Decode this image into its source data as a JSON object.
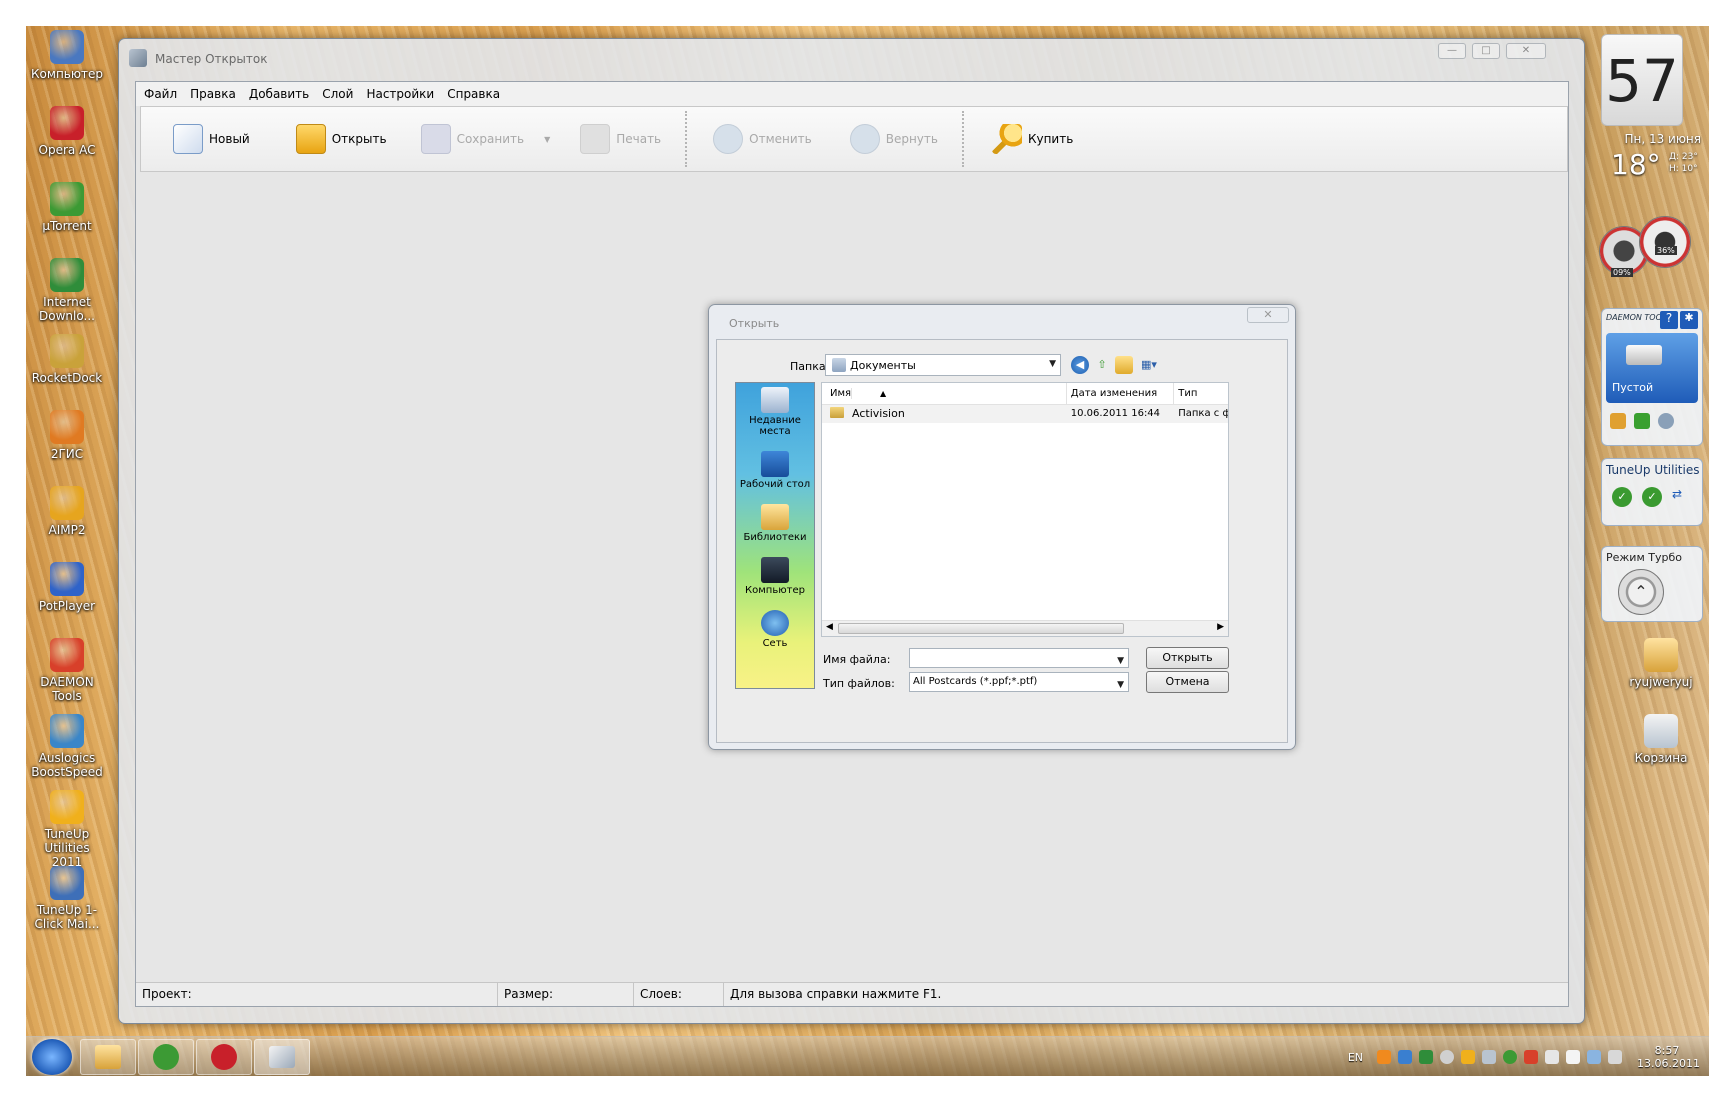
{
  "desktop_icons": [
    {
      "label": "Компьютер",
      "icon": "computer-icon",
      "color": "#4a78c0"
    },
    {
      "label": "Opera AC",
      "icon": "opera-icon",
      "color": "#c8202a"
    },
    {
      "label": "µTorrent",
      "icon": "utorrent-icon",
      "color": "#3c9a34"
    },
    {
      "label": "Internet Downlo...",
      "icon": "internet-download-icon",
      "color": "#2f8d3a"
    },
    {
      "label": "RocketDock",
      "icon": "rocketdock-icon",
      "color": "#c9a23a"
    },
    {
      "label": "2ГИС",
      "icon": "2gis-icon",
      "color": "#e07a22"
    },
    {
      "label": "AIMP2",
      "icon": "aimp-icon",
      "color": "#e6a51e"
    },
    {
      "label": "PotPlayer",
      "icon": "potplayer-icon",
      "color": "#2f63c9"
    },
    {
      "label": "DAEMON Tools",
      "icon": "daemon-tools-icon",
      "color": "#d8402a"
    },
    {
      "label": "Auslogics BoostSpeed",
      "icon": "auslogics-icon",
      "color": "#3a86c8"
    },
    {
      "label": "TuneUp Utilities 2011",
      "icon": "tuneup-icon",
      "color": "#f0b01c"
    },
    {
      "label": "TuneUp 1-Click Mai...",
      "icon": "tuneup-1click-icon",
      "color": "#3e6fb8"
    }
  ],
  "right_icons": [
    {
      "label": "ryujweryuj",
      "icon": "folder-icon"
    },
    {
      "label": "Корзина",
      "icon": "recycle-bin-icon"
    }
  ],
  "app": {
    "title": "Мастер Открыток",
    "menu": [
      "Файл",
      "Правка",
      "Добавить",
      "Слой",
      "Настройки",
      "Справка"
    ],
    "toolbar": {
      "new": "Новый",
      "open": "Открыть",
      "save": "Сохранить",
      "print": "Печать",
      "undo": "Отменить",
      "redo": "Вернуть",
      "buy": "Купить"
    },
    "status": {
      "project": "Проект:",
      "size": "Размер:",
      "layers": "Слоев:",
      "help": "Для вызова справки нажмите F1."
    }
  },
  "dialog": {
    "title": "Открыть",
    "lookin_label": "Папка:",
    "lookin_value": "Документы",
    "places": [
      "Недавние места",
      "Рабочий стол",
      "Библиотеки",
      "Компьютер",
      "Сеть"
    ],
    "columns": {
      "name": "Имя",
      "date": "Дата изменения",
      "type": "Тип"
    },
    "files": [
      {
        "name": "Activision",
        "date": "10.06.2011 16:44",
        "type": "Папка с ф"
      }
    ],
    "filename_label": "Имя файла:",
    "filename_value": "",
    "filetype_label": "Тип файлов:",
    "filetype_value": "All Postcards (*.ppf;*.ptf)",
    "open_button": "Открыть",
    "cancel_button": "Отмена"
  },
  "gadgets": {
    "clock_minutes": "57",
    "weather_date": "Пн, 13 июня",
    "weather_temp": "18°",
    "weather_high": "Д: 23°",
    "weather_low": "Н: 10°",
    "cpu_percent": "36%",
    "mem_percent": "09%",
    "daemon_status": "Пустой",
    "tuneup_title": "TuneUp Utilities",
    "turbo_label": "Режим Турбо"
  },
  "taskbar": {
    "language": "EN",
    "time": "8:57",
    "date": "13.06.2011"
  }
}
